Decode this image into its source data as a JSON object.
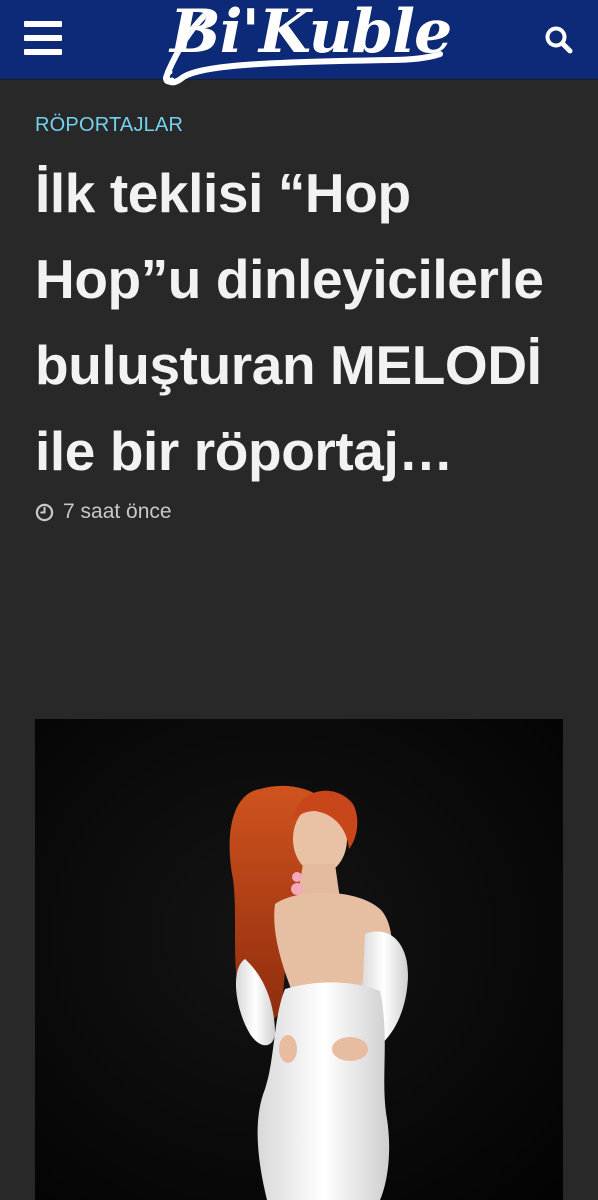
{
  "header": {
    "logo_text": "Bi'Kuble",
    "menu_icon": "hamburger-menu-icon",
    "search_icon": "search-icon",
    "background_color": "#0c2a78"
  },
  "article": {
    "category": "RÖPORTAJLAR",
    "title": "İlk teklisi “Hop Hop”u dinleyicilerle buluşturan MELODİ ile bir röportaj…",
    "time_icon": "clock-icon",
    "timestamp": "7 saat önce"
  },
  "colors": {
    "page_background": "#282828",
    "category_color": "#73d2f0",
    "title_color": "#f2f2f2",
    "meta_color": "#c8c8c8"
  }
}
